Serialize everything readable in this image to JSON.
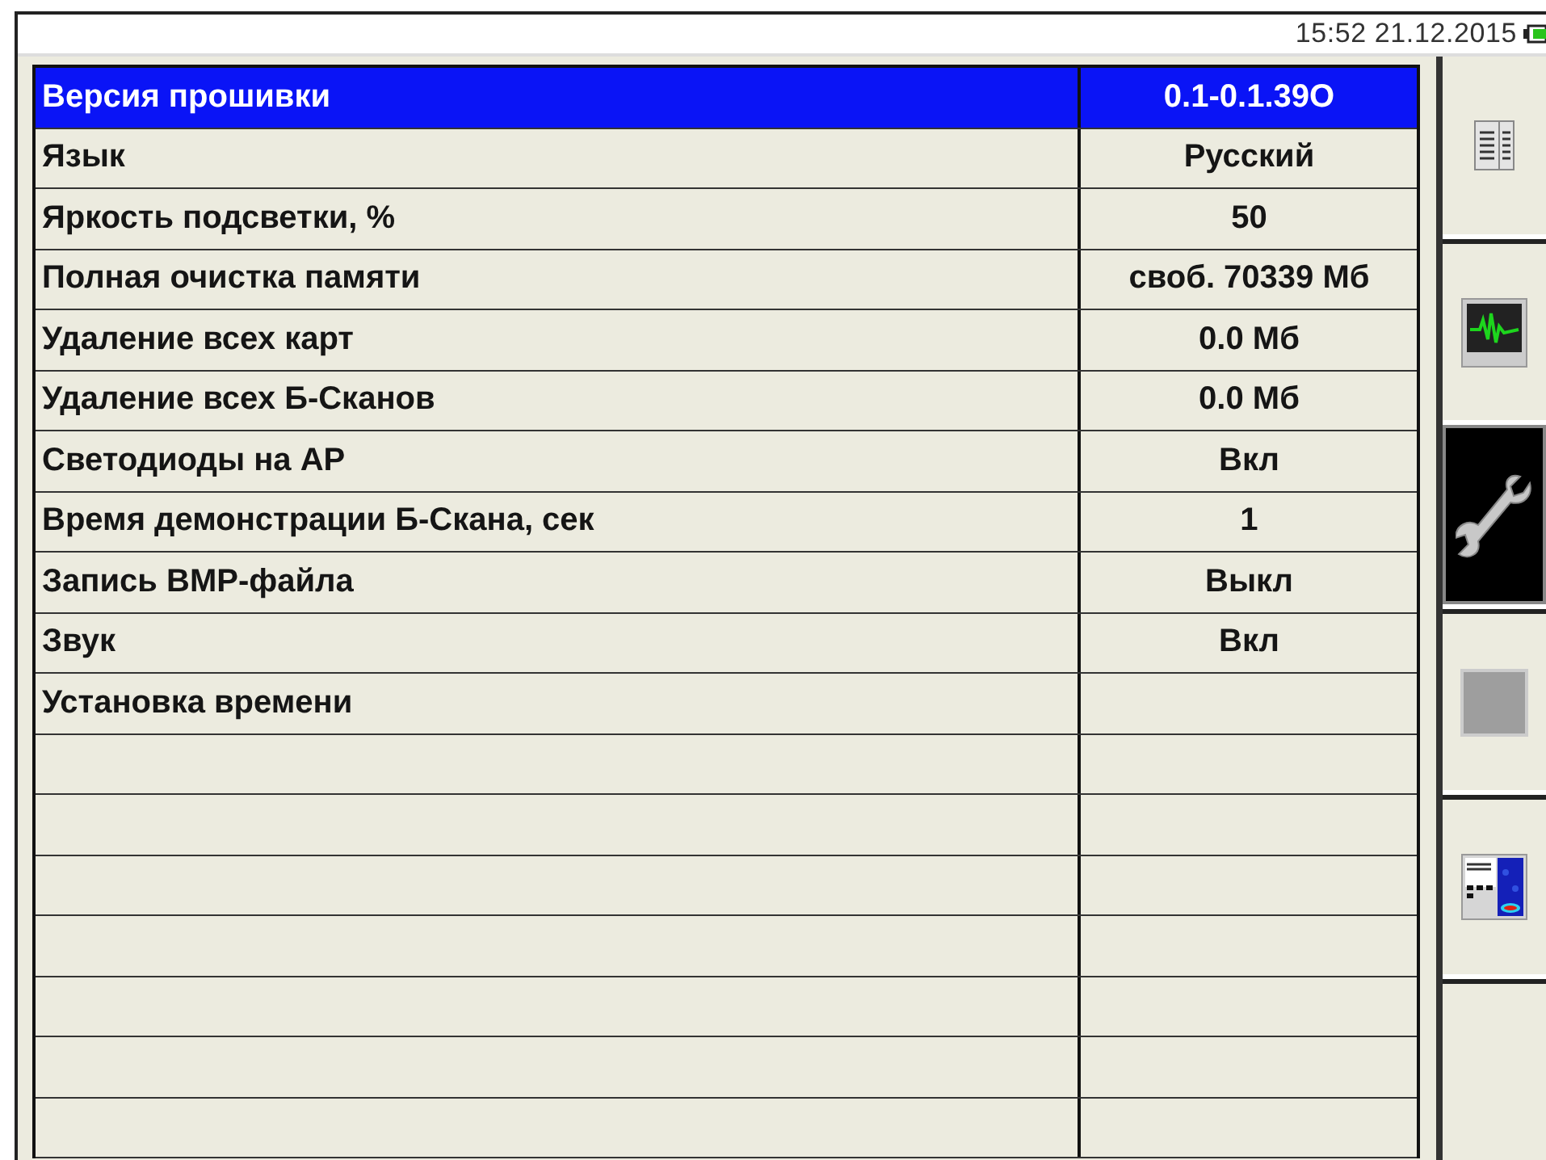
{
  "status_bar": {
    "datetime": "15:52 21.12.2015"
  },
  "settings": {
    "rows": [
      {
        "label": "Версия прошивки",
        "value": "0.1-0.1.39O",
        "selected": true
      },
      {
        "label": "Язык",
        "value": "Русский",
        "selected": false
      },
      {
        "label": "Яркость подсветки, %",
        "value": "50",
        "selected": false
      },
      {
        "label": "Полная очистка памяти",
        "value": "своб. 70339 Мб",
        "selected": false
      },
      {
        "label": "Удаление всех карт",
        "value": "0.0 Мб",
        "selected": false
      },
      {
        "label": "Удаление всех Б-Сканов",
        "value": "0.0 Мб",
        "selected": false
      },
      {
        "label": "Светодиоды на АР",
        "value": "Вкл",
        "selected": false
      },
      {
        "label": "Время демонстрации Б-Скана, сек",
        "value": "1",
        "selected": false
      },
      {
        "label": "Запись BMP-файла",
        "value": "Выкл",
        "selected": false
      },
      {
        "label": "Звук",
        "value": "Вкл",
        "selected": false
      },
      {
        "label": "Установка времени",
        "selected": false
      },
      {
        "selected": false
      },
      {
        "selected": false
      },
      {
        "selected": false
      },
      {
        "selected": false
      },
      {
        "selected": false
      },
      {
        "selected": false
      },
      {
        "selected": false
      }
    ]
  },
  "sidebar": {
    "buttons": [
      {
        "selected": false
      },
      {
        "selected": false
      },
      {
        "selected": true
      },
      {
        "selected": false
      },
      {
        "selected": false
      },
      {
        "selected": false
      }
    ]
  }
}
